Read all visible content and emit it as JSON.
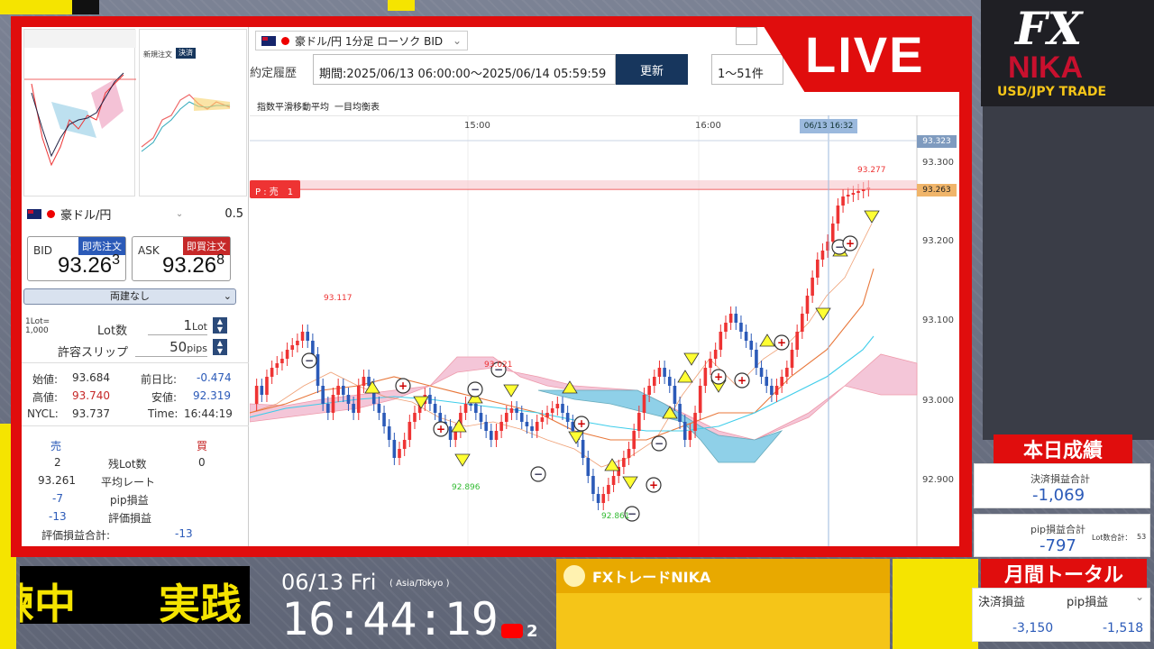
{
  "app": {
    "live_label": "LIVE",
    "logo_text": "FX",
    "logo_name": "NIKA",
    "logo_sub": "USD/JPY TRADE"
  },
  "chart_header": {
    "symbol": "豪ドル/円 1分足 ローソク BID",
    "history_label": "約定履歴",
    "period": "期間:2025/06/13 06:00:00〜2025/06/14 05:59:59",
    "update_button": "更新",
    "range_select": "1〜51件",
    "indicator1": "指数平滑移動平均",
    "indicator2": "一目均衡表",
    "position_label": "P : 売　1",
    "cursor_time": "06/13 16:32",
    "time_ticks": [
      "15:00",
      "16:00"
    ],
    "price_ticks": [
      "93.300",
      "93.200",
      "93.100",
      "93.000",
      "92.900"
    ],
    "price_tag_top": "93.323",
    "price_tag_cur": "93.263",
    "high_label": "93.277",
    "label_93117": "93.117",
    "label_92896": "92.896",
    "label_92861": "92.861",
    "label_mid": "93.021"
  },
  "order_panel": {
    "symbol": "豪ドル/円",
    "spread": "0.5",
    "bid_label": "BID",
    "bid_button": "即売注文",
    "bid_price_main": "93.26",
    "bid_price_sup": "3",
    "ask_label": "ASK",
    "ask_button": "即買注文",
    "ask_price_main": "93.26",
    "ask_price_sup": "8",
    "hedge_select": "両建なし",
    "lot_note": "1Lot=\n1,000",
    "lot_label": "Lot数",
    "lot_value": "1",
    "lot_unit": "Lot",
    "slip_label": "許容スリップ",
    "slip_value": "50",
    "slip_unit": "pips"
  },
  "stats": {
    "open_label": "始値:",
    "open": "93.684",
    "prev_label": "前日比:",
    "prev": "-0.474",
    "high_label": "高値:",
    "high": "93.740",
    "low_label": "安値:",
    "low": "92.319",
    "nycl_label": "NYCL:",
    "nycl": "93.737",
    "time_label": "Time:",
    "time": "16:44:19"
  },
  "position": {
    "sell_label": "売",
    "buy_label": "買",
    "sell_lots": "2",
    "lots_label": "残Lot数",
    "buy_lots": "0",
    "avg_sell": "93.261",
    "avg_label": "平均レート",
    "pips_sell": "-7",
    "pips_label": "pip損益",
    "eval_sell": "-13",
    "eval_label": "評価損益",
    "total_label": "評価損益合計:",
    "total": "-13"
  },
  "thumbs": {
    "t1_tab": "新規注文",
    "t1_btn": "決済"
  },
  "results": {
    "today_header": "本日成績",
    "settled_label": "決済損益合計",
    "settled": "-1,069",
    "pip_label": "pip損益合計",
    "pip": "-797",
    "trades_label": "Lot数合計：",
    "trades": "53",
    "month_header": "月間トータル",
    "m_settled_label": "決済損益",
    "m_pip_label": "pip損益",
    "m_settled": "-3,150",
    "m_pip": "-1,518"
  },
  "bottom": {
    "ticker": "練中　　実践",
    "date": "06/13 Fri",
    "tz": "( Asia/Tokyo )",
    "clock": "16:44:19",
    "viewers": "2",
    "chat_name": "FXトレードNIKA"
  }
}
